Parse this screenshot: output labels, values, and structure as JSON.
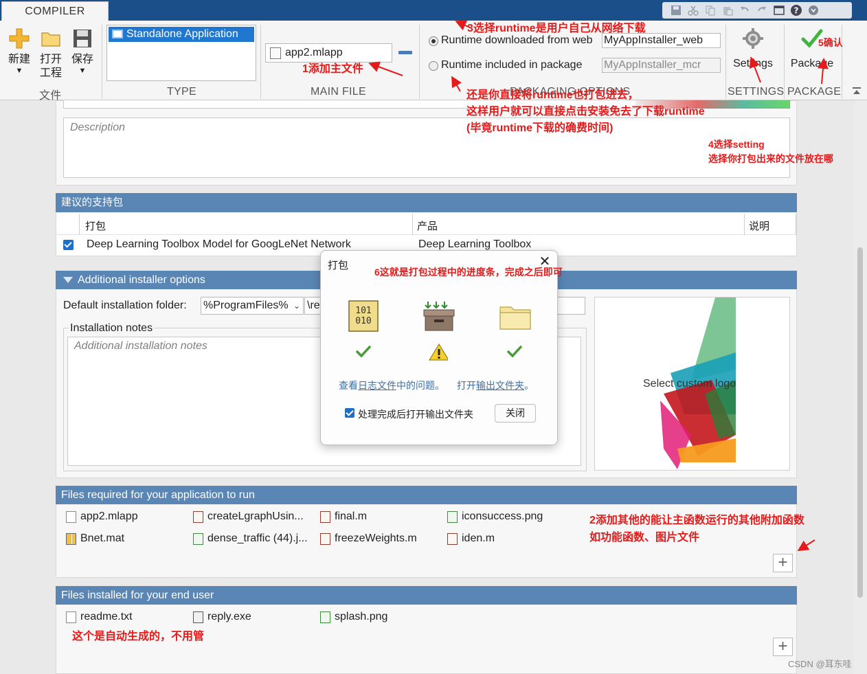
{
  "tabs": {
    "compiler": "COMPILER"
  },
  "ribbon": {
    "file": {
      "new": "新建",
      "open_line1": "打开",
      "open_line2": "工程",
      "save": "保存",
      "section": "文件"
    },
    "type": {
      "selected": "Standalone Application",
      "section": "TYPE"
    },
    "main_file": {
      "value": "app2.mlapp",
      "section": "MAIN FILE"
    },
    "packaging": {
      "web_label": "Runtime downloaded from web",
      "web_value": "MyAppInstaller_web",
      "pkg_label": "Runtime included in package",
      "pkg_value": "MyAppInstaller_mcr",
      "section": "PACKAGING OPTIONS"
    },
    "settings": {
      "label": "Settings",
      "section": "SETTINGS"
    },
    "package": {
      "label": "Package",
      "section": "PACKAGE"
    }
  },
  "description_placeholder": "Description",
  "support_packages": {
    "title": "建议的支持包",
    "columns": [
      "打包",
      "产品",
      "说明"
    ],
    "row": {
      "package": "Deep Learning Toolbox Model for GoogLeNet Network",
      "product": "Deep Learning Toolbox"
    }
  },
  "installer_options": {
    "title": "Additional installer options",
    "folder_label": "Default installation folder:",
    "folder_value": "%ProgramFiles%",
    "folder_suffix": "\\re",
    "notes_label": "Installation notes",
    "notes_placeholder": "Additional installation notes",
    "logo_label": "Select custom logo"
  },
  "files_required": {
    "title": "Files required for your application to run",
    "files": [
      "app2.mlapp",
      "createLgraphUsin...",
      "final.m",
      "iconsuccess.png",
      "Bnet.mat",
      "dense_traffic (44).j...",
      "freezeWeights.m",
      "iden.m"
    ]
  },
  "files_installed": {
    "title": "Files installed for your end user",
    "files": [
      "readme.txt",
      "reply.exe",
      "splash.png"
    ]
  },
  "modal": {
    "title": "打包",
    "link1_prefix": "查看",
    "link1_link": "日志文件",
    "link1_suffix": "中的问题。",
    "link2_prefix": "打开",
    "link2_link": "输出文件夹",
    "link2_suffix": "。",
    "checkbox_label": "处理完成后打开输出文件夹",
    "close_button": "关闭"
  },
  "annotations": {
    "a1": "1添加主文件",
    "a3": "3选择runtime是用户自己从网络下载",
    "a5": "5确认",
    "a_pkg_1": "还是你直接将runtime也打包进去，",
    "a_pkg_2": "这样用户就可以直接点击安装免去了下载runtime",
    "a_pkg_3": "(毕竟runtime下载的确费时间)",
    "a4_1": "4选择setting",
    "a4_2": "选择你打包出来的文件放在哪",
    "a6": "6这就是打包过程中的进度条，完成之后即可",
    "a2_1": "2添加其他的能让主函数运行的其他附加函数",
    "a2_2": "如功能函数、图片文件",
    "a_auto": "这个是自动生成的，不用管"
  },
  "watermark": "CSDN @耳东哇",
  "colors": {
    "title_bar": "#1b4f8a",
    "panel_header": "#5a86b5",
    "selection": "#1f77d0",
    "annotation": "#e51a1a"
  }
}
